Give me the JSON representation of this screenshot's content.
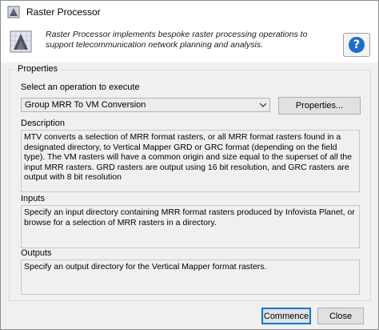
{
  "window": {
    "title": "Raster Processor"
  },
  "header": {
    "description": "Raster Processor implements bespoke raster processing operations to support telecommunication network planning and analysis.",
    "help_label": "?"
  },
  "properties_group": {
    "title": "Properties",
    "select_label": "Select an operation to execute",
    "selected_operation": "Group MRR To VM Conversion",
    "properties_button": "Properties...",
    "description_label": "Description",
    "description_text": "MTV converts a selection of MRR format rasters, or all MRR format rasters found in a designated directory, to Vertical Mapper GRD or GRC format (depending on the field type). The VM rasters will have a common origin and size equal to the superset of all the input MRR rasters. GRD rasters are output using 16 bit resolution, and GRC rasters are output with 8 bit resolution",
    "inputs_label": "Inputs",
    "inputs_text": "Specify an input directory containing MRR format rasters produced by Infovista Planet, or browse for a selection of MRR rasters in a directory.",
    "outputs_label": "Outputs",
    "outputs_text": "Specify an output directory for the Vertical Mapper format rasters."
  },
  "footer": {
    "commence_button": "Commence",
    "close_button": "Close"
  },
  "icons": {
    "title_icon": "raster-icon",
    "app_icon": "raster-icon",
    "help_icon": "help-icon",
    "dropdown_icon": "chevron-down-icon"
  },
  "colors": {
    "accent": "#0078d7",
    "help_icon": "#1f6ec6"
  }
}
